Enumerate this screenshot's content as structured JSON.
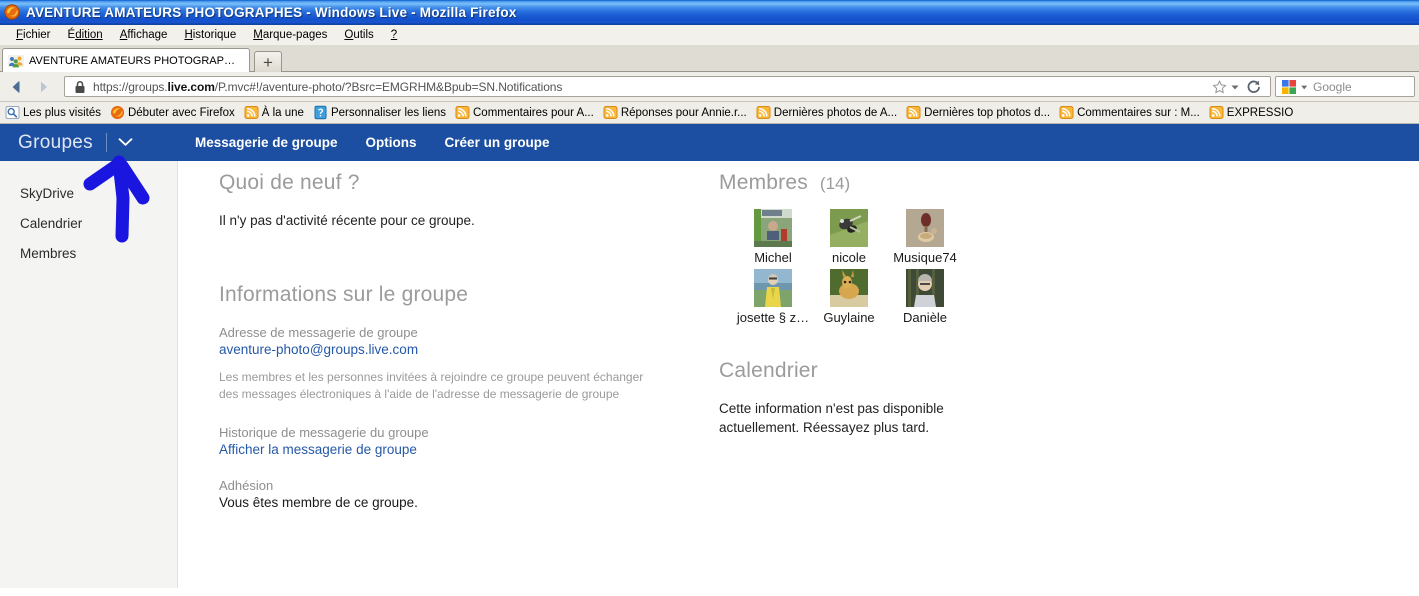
{
  "browser": {
    "title": "AVENTURE AMATEURS PHOTOGRAPHES - Windows Live - Mozilla Firefox",
    "title_main": "AVENTURE AMATEURS PHOTOGRAPHES",
    "title_rest": " - Windows Live - Mozilla Firefox",
    "menu": [
      {
        "label": "Fichier",
        "acc": "F",
        "rest": "ichier"
      },
      {
        "label": "Édition",
        "acc": "É",
        "rest": "dition"
      },
      {
        "label": "Affichage",
        "acc": "A",
        "rest": "ffichage"
      },
      {
        "label": "Historique",
        "acc": "H",
        "rest": "istorique"
      },
      {
        "label": "Marque-pages",
        "acc": "M",
        "rest": "arque-pages"
      },
      {
        "label": "Outils",
        "acc": "O",
        "rest": "utils"
      },
      {
        "label": "?",
        "acc": "?",
        "rest": ""
      }
    ],
    "tab": {
      "label": "AVENTURE AMATEURS PHOTOGRAPHES - W...",
      "newtab_label": "+"
    },
    "url": "https://groups.live.com/P.mvc#!/aventure-photo/?Bsrc=EMGRHM&Bpub=SN.Notifications",
    "url_prefix": "https://groups.",
    "url_domain": "live.com",
    "url_suffix": "/P.mvc#!/aventure-photo/?Bsrc=EMGRHM&Bpub=SN.Notifications",
    "search": {
      "engine": "Google",
      "placeholder": "Google",
      "value": ""
    },
    "bookmarks": [
      {
        "label": "Les plus visités",
        "icon": "most-visited-icon"
      },
      {
        "label": "Débuter avec Firefox",
        "icon": "firefox-icon"
      },
      {
        "label": "À la une",
        "icon": "rss-feed-icon"
      },
      {
        "label": "Personnaliser les liens",
        "icon": "customize-links-icon"
      },
      {
        "label": "Commentaires pour A...",
        "icon": "rss-feed-icon"
      },
      {
        "label": "Réponses pour Annie.r...",
        "icon": "rss-feed-icon"
      },
      {
        "label": "Dernières photos de A...",
        "icon": "rss-feed-icon"
      },
      {
        "label": "Dernières top photos d...",
        "icon": "rss-feed-icon"
      },
      {
        "label": "Commentaires sur : M...",
        "icon": "rss-feed-icon"
      },
      {
        "label": "EXPRESSIO",
        "icon": "rss-feed-icon"
      }
    ]
  },
  "livebar": {
    "brand": "Groupes",
    "chevron": "⌄",
    "items": [
      {
        "label": "Messagerie de groupe"
      },
      {
        "label": "Options"
      },
      {
        "label": "Créer un groupe"
      }
    ]
  },
  "sidebar": {
    "items": [
      {
        "label": "SkyDrive"
      },
      {
        "label": "Calendrier"
      },
      {
        "label": "Membres"
      }
    ]
  },
  "main": {
    "whatsnew": {
      "heading": "Quoi de neuf ?",
      "body": "Il n'y pas d'activité récente pour ce groupe."
    },
    "groupinfo": {
      "heading": "Informations sur le groupe",
      "email_label": "Adresse de messagerie de groupe",
      "email_value": "aventure-photo@groups.live.com",
      "email_help": "Les membres et les personnes invitées à rejoindre ce groupe peuvent échanger des messages électroniques à l'aide de l'adresse de messagerie de groupe",
      "history_label": "Historique de messagerie du groupe",
      "history_link": "Afficher la messagerie de groupe",
      "membership_label": "Adhésion",
      "membership_value": "Vous êtes membre de ce groupe."
    },
    "members": {
      "heading": "Membres",
      "count": "(14)",
      "list": [
        {
          "name": "Michel",
          "avatar": "avatar-michel"
        },
        {
          "name": "nicole",
          "avatar": "avatar-nicole"
        },
        {
          "name": "Musique74",
          "avatar": "avatar-musique74"
        },
        {
          "name": "josette § z…",
          "avatar": "avatar-josette"
        },
        {
          "name": "Guylaine",
          "avatar": "avatar-guylaine"
        },
        {
          "name": "Danièle",
          "avatar": "avatar-daniele"
        }
      ]
    },
    "calendar": {
      "heading": "Calendrier",
      "body": "Cette information n'est pas disponible actuellement. Réessayez plus tard."
    }
  },
  "annotation": {
    "shape": "hand-drawn-arrow",
    "color": "#1a16e0",
    "points_to": "Groupes dropdown chevron"
  },
  "colors": {
    "livebar_blue": "#1c4fa1",
    "link_blue": "#2458a8",
    "heading_gray": "#9b9b9b",
    "titlebar_blue": "#1c5fd6",
    "annotation_blue": "#1a16e0"
  }
}
